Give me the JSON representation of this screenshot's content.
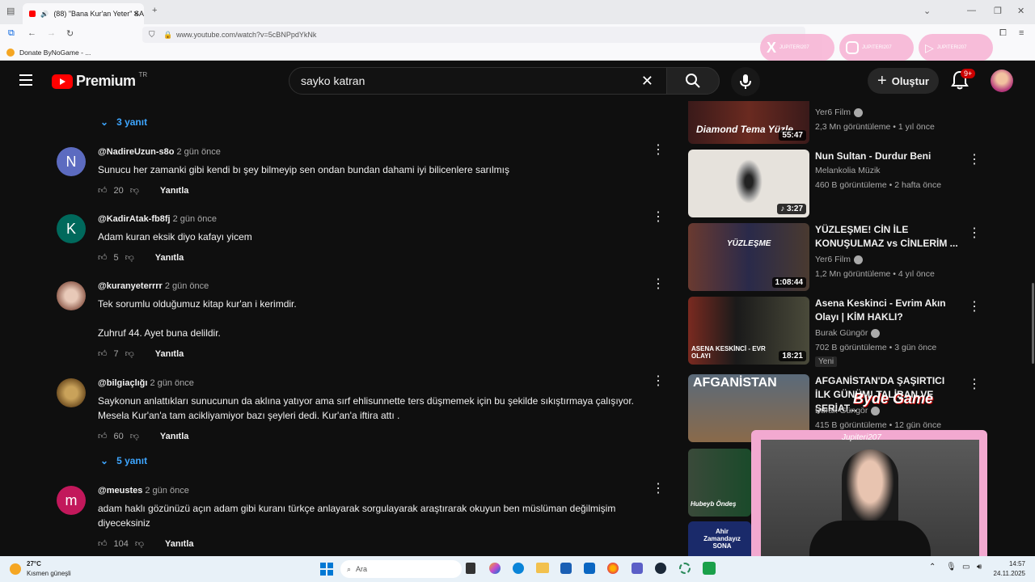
{
  "browser": {
    "tab_title": "(88) \"Bana Kur'an Yeter\" SA",
    "url": "www.youtube.com/watch?v=5cBNPpdYkNk",
    "bookmark": "Donate ByNoGame - ..."
  },
  "header": {
    "logo_text": "Premium",
    "region": "TR",
    "search_value": "sayko katran",
    "create_label": "Oluştur",
    "notif_badge": "9+"
  },
  "comments": {
    "top_replies": "3 yanıt",
    "items": [
      {
        "user": "@NadireUzun-s8o",
        "time": "2 gün önce",
        "text": "Sunucu her zamanki gibi kendi bı şey bilmeyip sen ondan bundan dahami iyi bilicenlere sarılmış",
        "likes": "20",
        "reply": "Yanıtla",
        "avatar": "N",
        "avatar_color": "#5c6bc0"
      },
      {
        "user": "@KadirAtak-fb8fj",
        "time": "2 gün önce",
        "text": "Adam kuran eksik diyo kafayı yicem",
        "likes": "5",
        "reply": "Yanıtla",
        "avatar": "K",
        "avatar_color": "#00695c"
      },
      {
        "user": "@kuranyeterrrr",
        "time": "2 gün önce",
        "text": "Tek sorumlu olduğumuz kitap kur'an i kerimdir.\n\nZuhruf 44. Ayet buna delildir.",
        "likes": "7",
        "reply": "Yanıtla",
        "avatar": "",
        "avatar_color": "#8d5a4a"
      },
      {
        "user": "@bilgiaçlığı",
        "time": "2 gün önce",
        "text": "Saykonun anlattıkları sunucunun da aklına yatıyor ama sırf ehlisunnette ters düşmemek için bu şekilde sıkıştırmaya çalışıyor.\nMesela Kur'an'a tam acikliyamiyor bazı şeyleri dedi. Kur'an'a iftira attı .",
        "likes": "60",
        "reply": "Yanıtla",
        "avatar": "",
        "avatar_color": "#6b4a1e"
      },
      {
        "user": "@meustes",
        "time": "2 gün önce",
        "text": "adam haklı gözünüzü açın adam gibi kuranı türkçe anlayarak sorgulayarak araştırarak okuyun ben müslüman değilmişim diyeceksiniz",
        "likes": "104",
        "reply": "Yanıtla",
        "avatar": "m",
        "avatar_color": "#c2185b"
      }
    ],
    "replies_2": "5 yanıt"
  },
  "sidebar": {
    "videos": [
      {
        "title": "",
        "channel": "Yer6 Film",
        "meta": "2,3 Mn görüntüleme • 1 yıl önce",
        "duration": "55:47",
        "thumb_text": "Diamond Tema Yüzle"
      },
      {
        "title": "Nun Sultan - Durdur Beni",
        "channel": "Melankolia Müzik",
        "meta": "460 B görüntüleme • 2 hafta önce",
        "duration": "3:27",
        "thumb_text": ""
      },
      {
        "title": "YÜZLEŞME! CİN İLE KONUŞULMAZ vs CİNLERİM ...",
        "channel": "Yer6 Film",
        "meta": "1,2 Mn görüntüleme • 4 yıl önce",
        "duration": "1:08:44",
        "thumb_text": "YÜZLEŞME"
      },
      {
        "title": "Asena Keskinci - Evrim Akın Olayı | KİM HAKLI?",
        "channel": "Burak Güngör",
        "meta": "702 B görüntüleme • 3 gün önce",
        "duration": "18:21",
        "badge": "Yeni",
        "thumb_text": "ASENA KESKİNCİ - EVR OLAYI"
      },
      {
        "title": "AFGANİSTAN'DA ŞAŞIRTICI İLK GÜNÜM! TALİBAN VE ŞERİAT...",
        "channel": "Burak Güngör",
        "meta": "415 B görüntüleme • 12 gün önce",
        "duration": "",
        "thumb_text": "AFGANİSTAN"
      },
      {
        "title": "",
        "channel": "",
        "meta": "",
        "duration": "",
        "thumb_text": "Hubeyb Öndeş"
      },
      {
        "title": "",
        "channel": "",
        "meta": "",
        "duration": "",
        "thumb_text": "Ahir Zamandayız SONA"
      }
    ]
  },
  "overlay": {
    "stream_name": "Jupiteri207",
    "social_x": "JUPITERI207",
    "social_ig": "JUPITERI207",
    "social_yt": "JUPITERI207",
    "promo": "Byde Game"
  },
  "taskbar": {
    "weather_temp": "27°C",
    "weather_desc": "Kısmen güneşli",
    "search_label": "Ara",
    "time": "14:57",
    "date": "24.11.2025"
  },
  "colors": {
    "accent_blue": "#3ea6ff",
    "yt_red": "#ff0000",
    "bg": "#0f0f0f"
  }
}
